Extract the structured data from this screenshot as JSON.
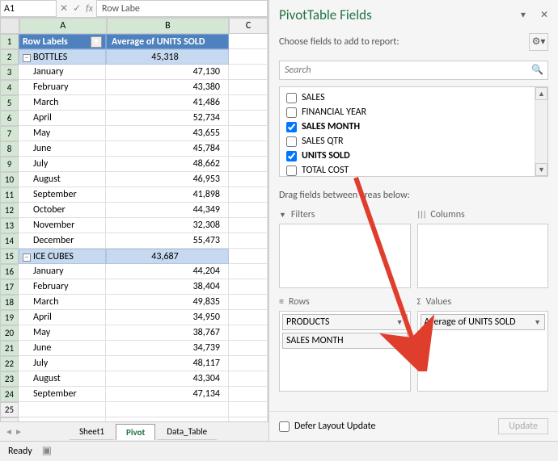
{
  "formula_bar": {
    "name_box": "A1",
    "formula": "Row Labe"
  },
  "columns": {
    "a": "A",
    "b": "B",
    "c": "C"
  },
  "pivot": {
    "header_a": "Row Labels",
    "header_b": "Average of UNITS SOLD",
    "groups": [
      {
        "label": "BOTTLES",
        "value": "45,318",
        "rows": [
          {
            "m": "January",
            "v": "47,130"
          },
          {
            "m": "February",
            "v": "43,380"
          },
          {
            "m": "March",
            "v": "41,486"
          },
          {
            "m": "April",
            "v": "52,734"
          },
          {
            "m": "May",
            "v": "43,655"
          },
          {
            "m": "June",
            "v": "45,784"
          },
          {
            "m": "July",
            "v": "48,662"
          },
          {
            "m": "August",
            "v": "46,953"
          },
          {
            "m": "September",
            "v": "41,898"
          },
          {
            "m": "October",
            "v": "44,349"
          },
          {
            "m": "November",
            "v": "32,308"
          },
          {
            "m": "December",
            "v": "55,473"
          }
        ]
      },
      {
        "label": "ICE CUBES",
        "value": "43,687",
        "rows": [
          {
            "m": "January",
            "v": "44,204"
          },
          {
            "m": "February",
            "v": "38,404"
          },
          {
            "m": "March",
            "v": "49,835"
          },
          {
            "m": "April",
            "v": "34,950"
          },
          {
            "m": "May",
            "v": "38,767"
          },
          {
            "m": "June",
            "v": "34,739"
          },
          {
            "m": "July",
            "v": "48,117"
          },
          {
            "m": "August",
            "v": "43,304"
          },
          {
            "m": "September",
            "v": "47,134"
          }
        ]
      }
    ]
  },
  "tabs": {
    "t1": "Sheet1",
    "t2": "Pivot",
    "t3": "Data_Table"
  },
  "status": "Ready",
  "pane": {
    "title": "PivotTable Fields",
    "subtitle": "Choose fields to add to report:",
    "search_placeholder": "Search",
    "fields": [
      {
        "name": "SALES",
        "checked": false
      },
      {
        "name": "FINANCIAL YEAR",
        "checked": false
      },
      {
        "name": "SALES MONTH",
        "checked": true
      },
      {
        "name": "SALES QTR",
        "checked": false
      },
      {
        "name": "UNITS SOLD",
        "checked": true
      },
      {
        "name": "TOTAL COST",
        "checked": false
      }
    ],
    "drag_label": "Drag fields between areas below:",
    "area_filters": "Filters",
    "area_columns": "Columns",
    "area_rows": "Rows",
    "area_values": "Values",
    "rows_items": [
      "PRODUCTS",
      "SALES MONTH"
    ],
    "values_items": [
      "Average of UNITS SOLD"
    ],
    "defer": "Defer Layout Update",
    "update": "Update"
  }
}
